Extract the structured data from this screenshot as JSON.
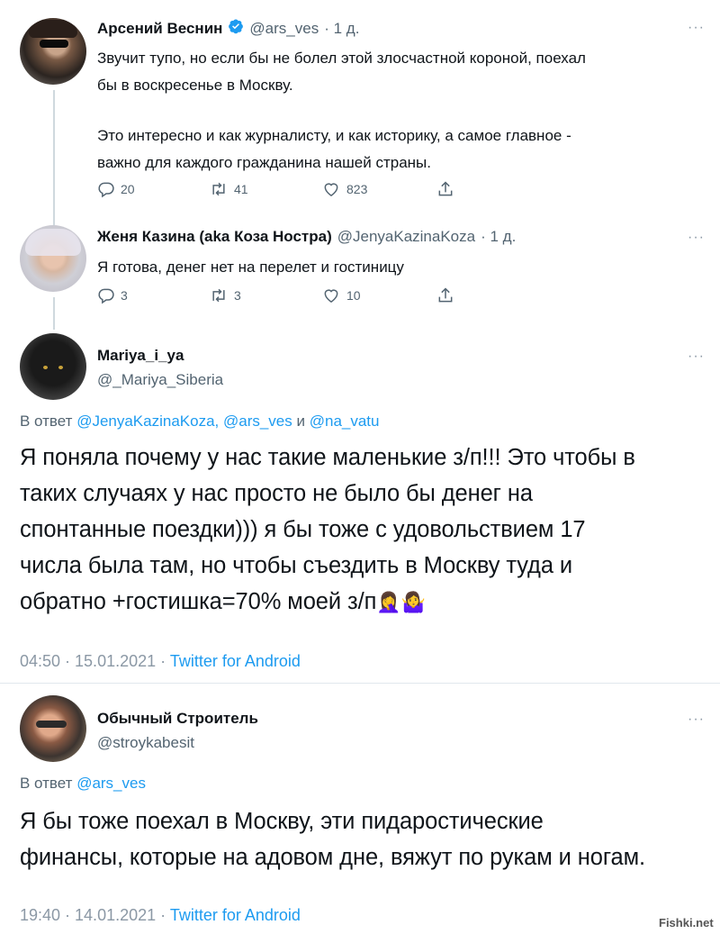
{
  "tweet1": {
    "name": "Арсений Веснин",
    "handle": "@ars_ves",
    "time": "· 1 д.",
    "text1": "Звучит тупо, но если бы не болел этой злосчастной короной, поехал",
    "text2": "бы в воскресенье в Москву.",
    "text3": "Это интересно и как журналисту, и как историку, а самое главное -",
    "text4": "важно для каждого гражданина нашей страны.",
    "replies": "20",
    "retweets": "41",
    "likes": "823"
  },
  "tweet2": {
    "name": "Женя Казина (aka Коза Ностра)",
    "handle": "@JenyaKazinaKoza",
    "time": "· 1 д.",
    "text": "Я готова, денег нет на перелет и гостиницу",
    "replies": "3",
    "retweets": "3",
    "likes": "10"
  },
  "tweet3": {
    "name": "Mariya_i_ya",
    "handle": "@_Mariya_Siberia",
    "reply_prefix": "В ответ",
    "reply_to": "@JenyaKazinaKoza, @ars_ves",
    "reply_and": "и",
    "reply_to_last": "@na_vatu",
    "line1": "Я поняла почему у нас такие маленькие з/п!!! Это чтобы в",
    "line2": "таких случаях у нас просто не было бы денег на",
    "line3": "спонтанные поездки))) я бы тоже с удовольствием 17",
    "line4": "числа была там, но чтобы съездить в Москву туда и",
    "line5": "обратно +гостишка=70% моей з/п",
    "emoji": "🤦‍♀️🤷‍♀️",
    "timestamp": "04:50 · 15.01.2021 ·",
    "source": "Twitter for Android"
  },
  "tweet4": {
    "name": "Обычный Строитель",
    "handle": "@stroykabesit",
    "reply_prefix": "В ответ",
    "reply_to": "@ars_ves",
    "line1": "Я бы тоже поехал в Москву, эти пидаростические",
    "line2": "финансы, которые на адовом дне, вяжут по рукам и ногам.",
    "timestamp": "19:40 · 14.01.2021 ·",
    "source": "Twitter for Android"
  },
  "watermark": "Fishki.net",
  "colors": {
    "verified": "#1d9bf0",
    "link": "#1d9bf0",
    "muted": "#536471",
    "meta": "#8b98a5"
  },
  "icons": [
    "verified-badge-icon",
    "reply-icon",
    "retweet-icon",
    "like-icon",
    "share-icon",
    "more-icon"
  ]
}
